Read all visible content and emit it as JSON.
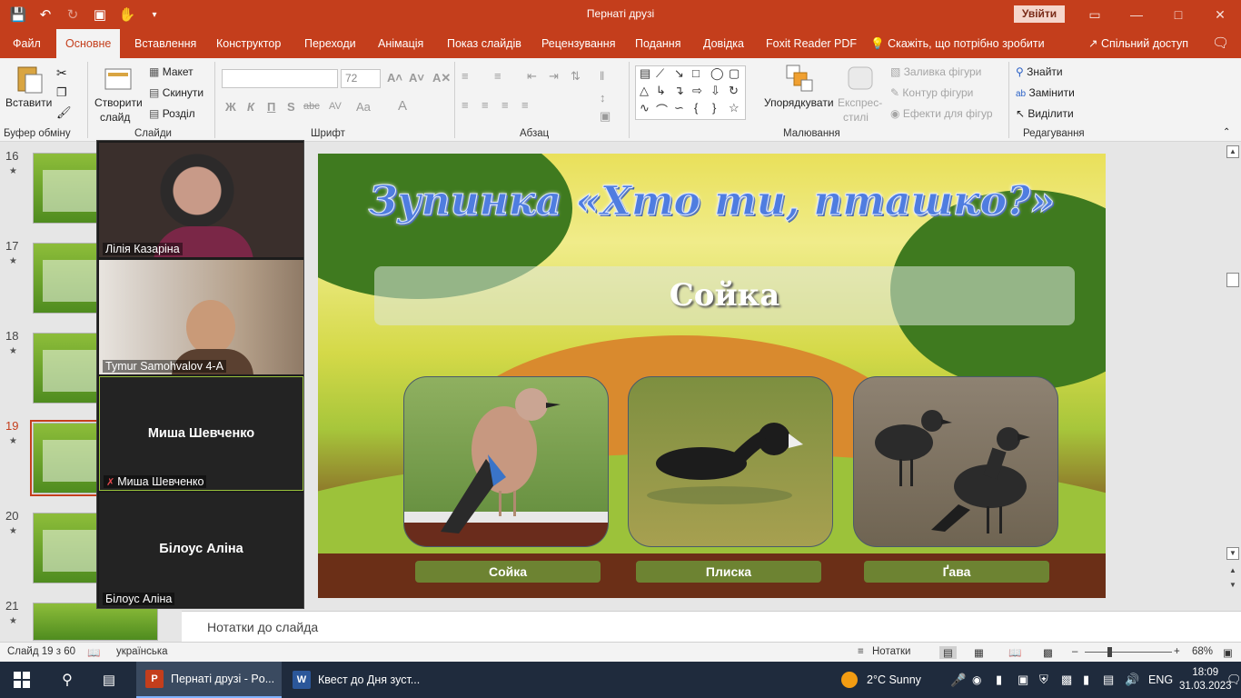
{
  "window": {
    "title": "Пернаті друзі",
    "signin_label": "Увійти",
    "qat_icons": [
      "save-icon",
      "undo-icon",
      "redo-icon",
      "start-from-beginning-icon",
      "touch-mode-icon",
      "customize-icon"
    ]
  },
  "ribbon_tabs": [
    {
      "label": "Файл",
      "active": false
    },
    {
      "label": "Основне",
      "active": true
    },
    {
      "label": "Вставлення",
      "active": false
    },
    {
      "label": "Конструктор",
      "active": false
    },
    {
      "label": "Переходи",
      "active": false
    },
    {
      "label": "Анімація",
      "active": false
    },
    {
      "label": "Показ слайдів",
      "active": false
    },
    {
      "label": "Рецензування",
      "active": false
    },
    {
      "label": "Подання",
      "active": false
    },
    {
      "label": "Довідка",
      "active": false
    },
    {
      "label": "Foxit Reader PDF",
      "active": false
    }
  ],
  "tell_me": "Скажіть, що потрібно зробити",
  "share_label": "Спільний доступ",
  "ribbon": {
    "clipboard": {
      "paste": "Вставити",
      "group": "Буфер обміну"
    },
    "slides": {
      "new_slide_line1": "Створити",
      "new_slide_line2": "слайд",
      "layout": "Макет",
      "reset": "Скинути",
      "section": "Розділ",
      "group": "Слайди"
    },
    "font": {
      "size": "72",
      "group": "Шрифт",
      "bold": "Ж",
      "italic": "К",
      "underline": "П",
      "shadow": "S",
      "strike": "abc",
      "spacing": "AV",
      "case": "Aa",
      "color": "A"
    },
    "paragraph": {
      "group": "Абзац"
    },
    "drawing": {
      "arrange": "Упорядкувати",
      "quick_styles_line1": "Експрес-",
      "quick_styles_line2": "стилі",
      "fill": "Заливка фігури",
      "outline": "Контур фігури",
      "effects": "Ефекти для фігур",
      "group": "Малювання"
    },
    "editing": {
      "find": "Знайти",
      "replace": "Замінити",
      "select": "Виділити",
      "group": "Редагування"
    }
  },
  "thumbnails": [
    {
      "number": "16",
      "active": false
    },
    {
      "number": "17",
      "active": false
    },
    {
      "number": "18",
      "active": false
    },
    {
      "number": "19",
      "active": true
    },
    {
      "number": "20",
      "active": false
    },
    {
      "number": "21",
      "active": false
    }
  ],
  "participants": [
    {
      "name": "Лілія Казаріна",
      "has_video": true,
      "muted": false,
      "speaking": false
    },
    {
      "name": "Tymur Samohvalov 4-A",
      "has_video": true,
      "muted": false,
      "speaking": false
    },
    {
      "name": "Миша Шевченко",
      "has_video": false,
      "muted": true,
      "speaking": true
    },
    {
      "name": "Білоус Аліна",
      "has_video": false,
      "muted": false,
      "speaking": false
    }
  ],
  "slide": {
    "title": "Зупинка  «Хто ти, пташко?»",
    "answer": "Сойка",
    "birds": [
      {
        "label": "Сойка",
        "image": "jay-photo"
      },
      {
        "label": "Плиска",
        "image": "coot-photo"
      },
      {
        "label": "Ґава",
        "image": "jackdaw-photo"
      }
    ]
  },
  "notes_placeholder": "Нотатки до слайда",
  "status": {
    "slide_info": "Слайд 19 з 60",
    "language": "українська",
    "notes_button": "Нотатки",
    "zoom": "68%"
  },
  "taskbar": {
    "apps": [
      {
        "label": "Пернаті друзі - Po...",
        "icon": "P",
        "active": true
      },
      {
        "label": "Квест  до Дня зуст...",
        "icon": "W",
        "active": false
      }
    ],
    "weather": "2°C  Sunny",
    "keyboard": "ENG",
    "time": "18:09",
    "date": "31.03.2023"
  },
  "colors": {
    "accent": "#c43e1c",
    "taskbar": "#1f2b3d",
    "slide_title": "#4f7de0"
  }
}
